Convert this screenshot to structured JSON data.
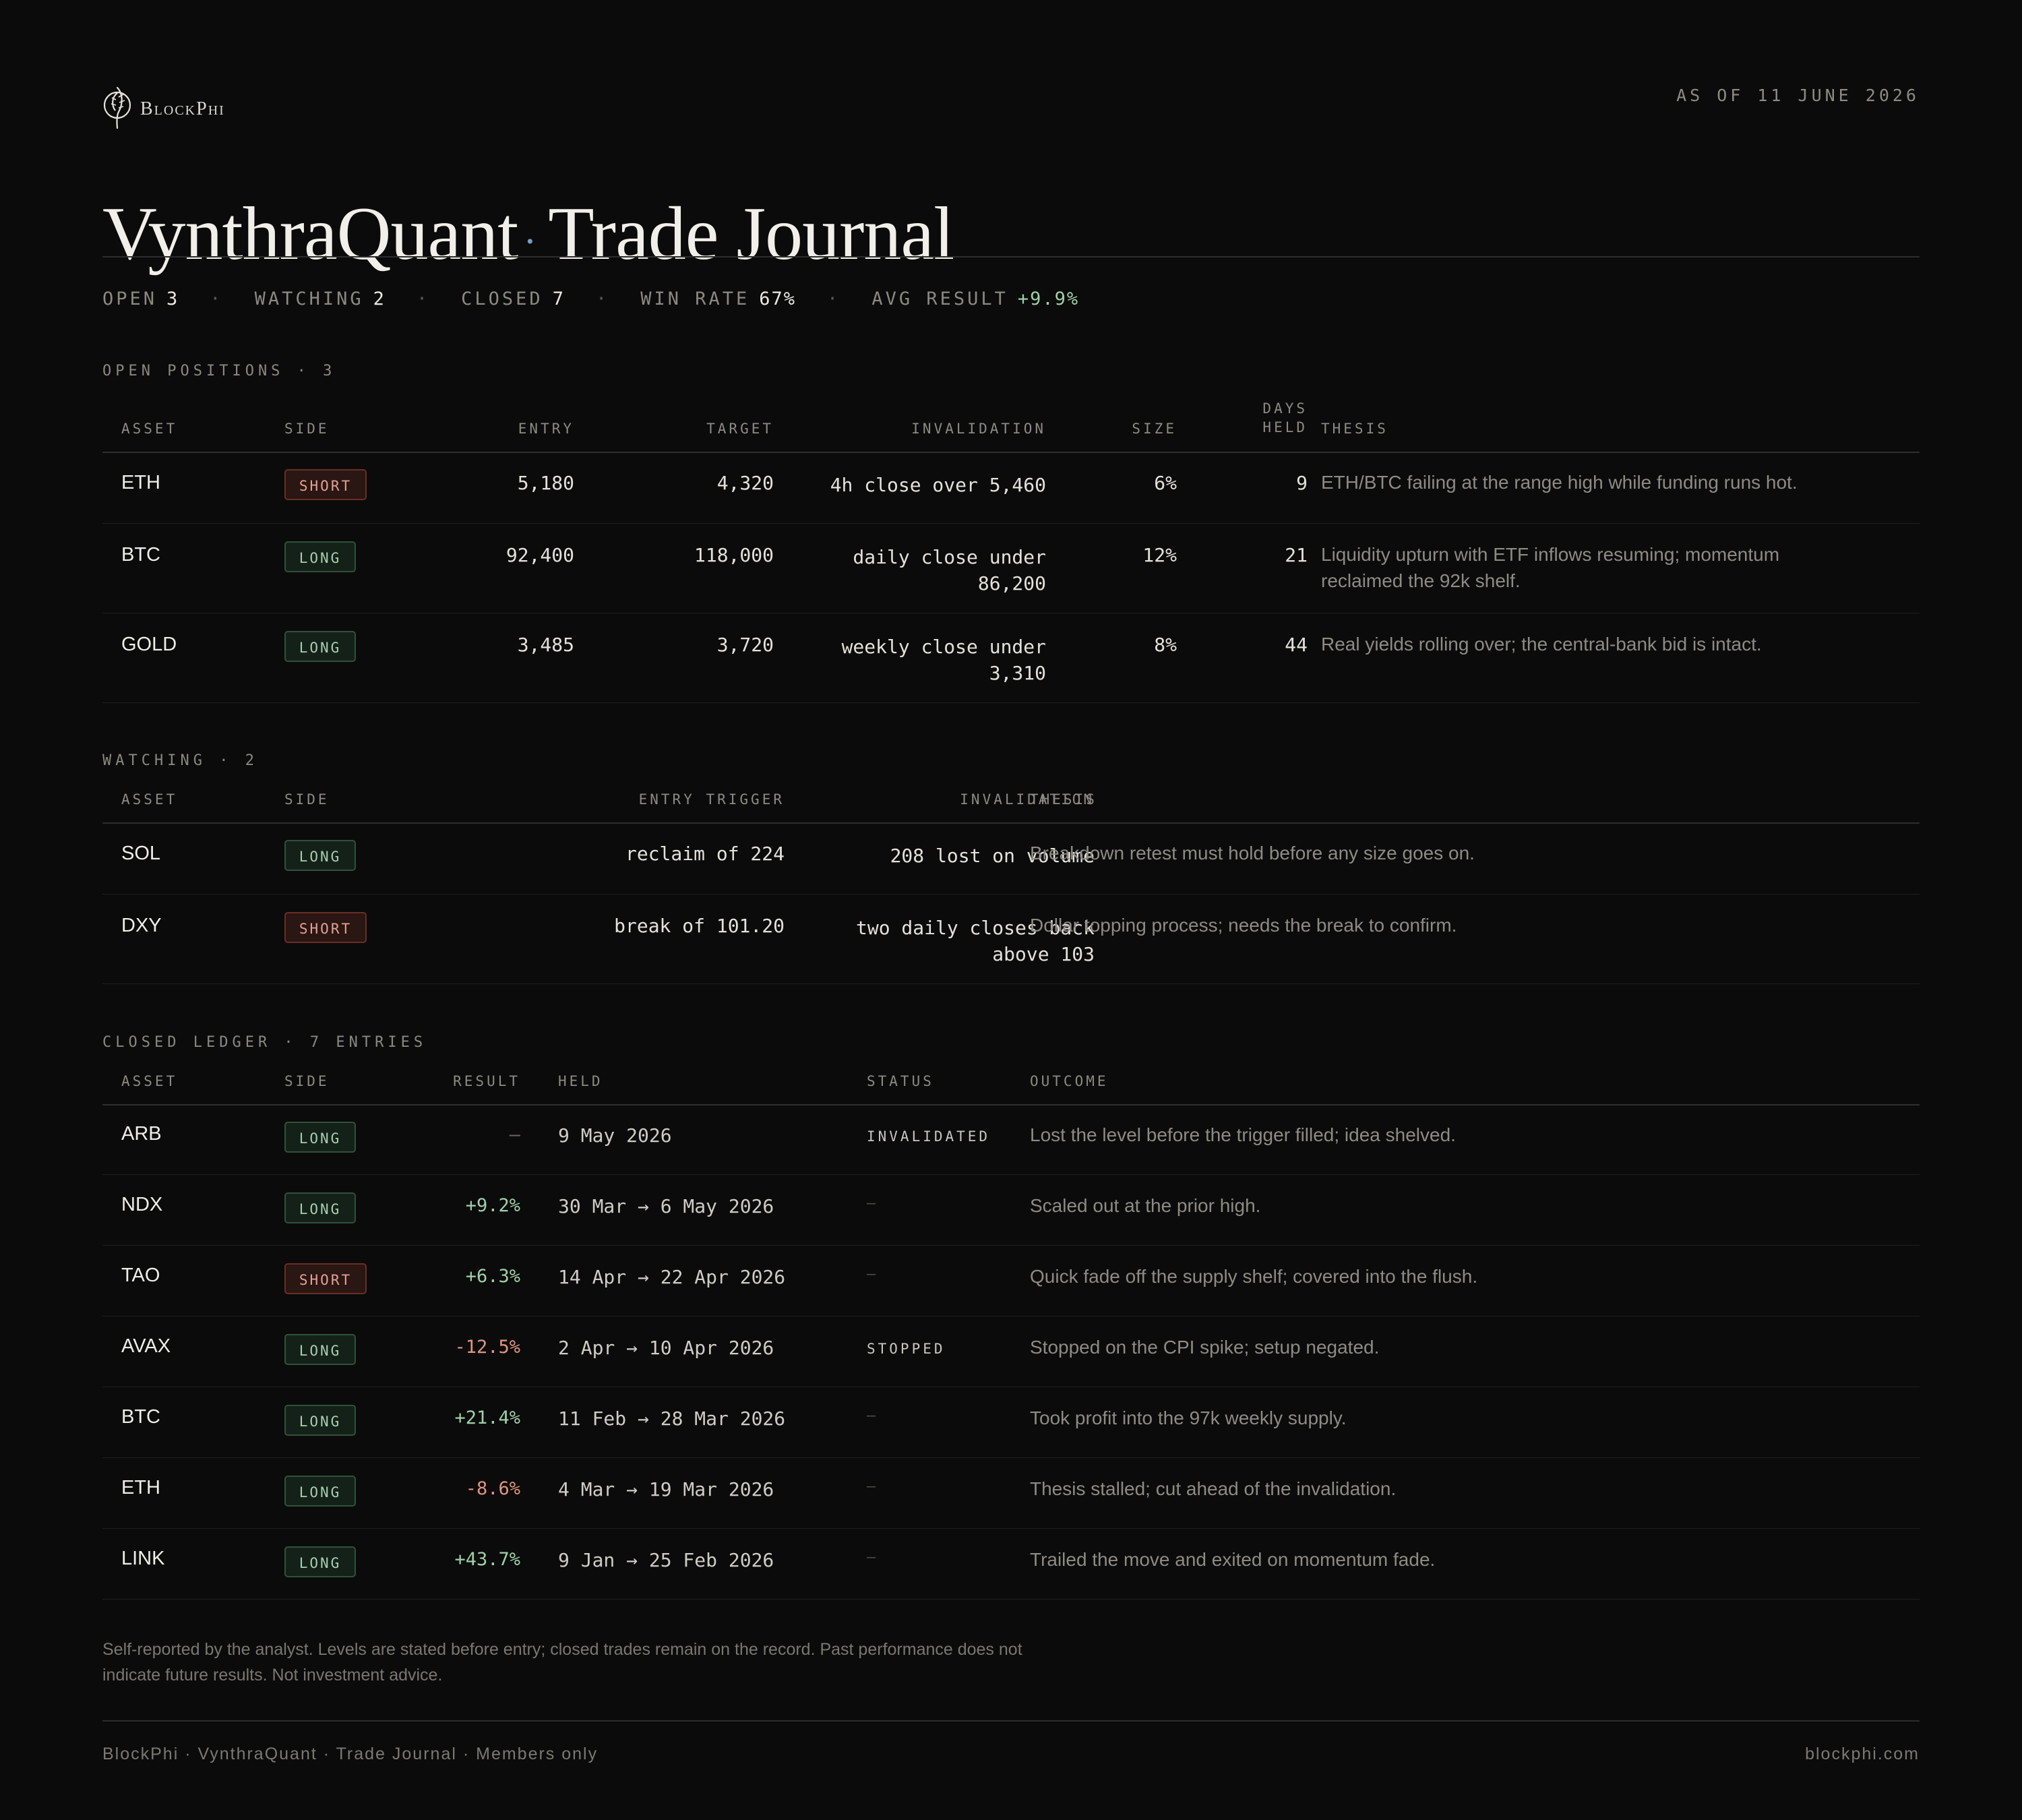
{
  "brand": {
    "name": "BlockPhi",
    "icon": "feather-icon"
  },
  "as_of": "AS OF 11 JUNE 2026",
  "title": {
    "main": "VynthraQuant",
    "dot": "·",
    "sub": "Trade Journal"
  },
  "stats": [
    {
      "label": "OPEN",
      "value": "3",
      "tone": "neutral"
    },
    {
      "label": "WATCHING",
      "value": "2",
      "tone": "neutral"
    },
    {
      "label": "CLOSED",
      "value": "7",
      "tone": "neutral"
    },
    {
      "label": "WIN RATE",
      "value": "67%",
      "tone": "neutral"
    },
    {
      "label": "AVG RESULT",
      "value": "+9.9%",
      "tone": "pos"
    }
  ],
  "stats_separator": "·",
  "open_positions": {
    "label": "OPEN POSITIONS · 3",
    "headers": {
      "asset": "ASSET",
      "side": "SIDE",
      "entry": "ENTRY",
      "target": "TARGET",
      "invalidation": "INVALIDATION",
      "size": "SIZE",
      "days_held_1": "DAYS",
      "days_held_2": "HELD",
      "thesis": "THESIS"
    },
    "rows": [
      {
        "asset": "ETH",
        "side": "SHORT",
        "entry": "5,180",
        "target": "4,320",
        "inv1": "4h close over 5,460",
        "inv2": "",
        "size": "6%",
        "days": "9",
        "thesis1": "ETH/BTC failing at the range high while funding runs hot.",
        "thesis2": ""
      },
      {
        "asset": "BTC",
        "side": "LONG",
        "entry": "92,400",
        "target": "118,000",
        "inv1": "daily close under",
        "inv2": "86,200",
        "size": "12%",
        "days": "21",
        "thesis1": "Liquidity upturn with ETF inflows resuming; momentum",
        "thesis2": "reclaimed the 92k shelf."
      },
      {
        "asset": "GOLD",
        "side": "LONG",
        "entry": "3,485",
        "target": "3,720",
        "inv1": "weekly close under",
        "inv2": "3,310",
        "size": "8%",
        "days": "44",
        "thesis1": "Real yields rolling over; the central-bank bid is intact.",
        "thesis2": ""
      }
    ]
  },
  "watching": {
    "label": "WATCHING · 2",
    "headers": {
      "asset": "ASSET",
      "side": "SIDE",
      "trigger": "ENTRY TRIGGER",
      "invalidation": "INVALIDATION",
      "thesis": "THESIS"
    },
    "rows": [
      {
        "asset": "SOL",
        "side": "LONG",
        "trigger": "reclaim of 224",
        "inv1": "208 lost on volume",
        "inv2": "",
        "thesis": "Breakdown retest must hold before any size goes on."
      },
      {
        "asset": "DXY",
        "side": "SHORT",
        "trigger": "break of 101.20",
        "inv1": "two daily closes back",
        "inv2": "above 103",
        "thesis": "Dollar topping process; needs the break to confirm."
      }
    ]
  },
  "closed": {
    "label": "CLOSED LEDGER · 7 ENTRIES",
    "headers": {
      "asset": "ASSET",
      "side": "SIDE",
      "result": "RESULT",
      "held": "HELD",
      "status": "STATUS",
      "outcome": "OUTCOME"
    },
    "rows": [
      {
        "asset": "ARB",
        "side": "LONG",
        "result": "–",
        "tone": "none",
        "held": "9 May 2026",
        "status": "INVALIDATED",
        "outcome": "Lost the level before the trigger filled; idea shelved."
      },
      {
        "asset": "NDX",
        "side": "LONG",
        "result": "+9.2%",
        "tone": "pos",
        "held": "30 Mar → 6 May 2026",
        "status": "–",
        "outcome": "Scaled out at the prior high."
      },
      {
        "asset": "TAO",
        "side": "SHORT",
        "result": "+6.3%",
        "tone": "pos",
        "held": "14 Apr → 22 Apr 2026",
        "status": "–",
        "outcome": "Quick fade off the supply shelf; covered into the flush."
      },
      {
        "asset": "AVAX",
        "side": "LONG",
        "result": "-12.5%",
        "tone": "neg",
        "held": "2 Apr → 10 Apr 2026",
        "status": "STOPPED",
        "outcome": "Stopped on the CPI spike; setup negated."
      },
      {
        "asset": "BTC",
        "side": "LONG",
        "result": "+21.4%",
        "tone": "pos",
        "held": "11 Feb → 28 Mar 2026",
        "status": "–",
        "outcome": "Took profit into the 97k weekly supply."
      },
      {
        "asset": "ETH",
        "side": "LONG",
        "result": "-8.6%",
        "tone": "neg",
        "held": "4 Mar → 19 Mar 2026",
        "status": "–",
        "outcome": "Thesis stalled; cut ahead of the invalidation."
      },
      {
        "asset": "LINK",
        "side": "LONG",
        "result": "+43.7%",
        "tone": "pos",
        "held": "9 Jan → 25 Feb 2026",
        "status": "–",
        "outcome": "Trailed the move and exited on momentum fade."
      }
    ]
  },
  "disclaimer1": "Self-reported by the analyst. Levels are stated before entry; closed trades remain on the record. Past performance does not",
  "disclaimer2": "indicate future results. Not investment advice.",
  "footer": {
    "left": "BlockPhi · VynthraQuant · Trade Journal · Members only",
    "right": "blockphi.com"
  },
  "colors": {
    "background": "#0b0b0b",
    "accent_dot": "#6f9fc8",
    "positive": "#9fd1a8",
    "negative": "#e2957f",
    "long_badge": "#142119",
    "short_badge": "#2a1613"
  }
}
